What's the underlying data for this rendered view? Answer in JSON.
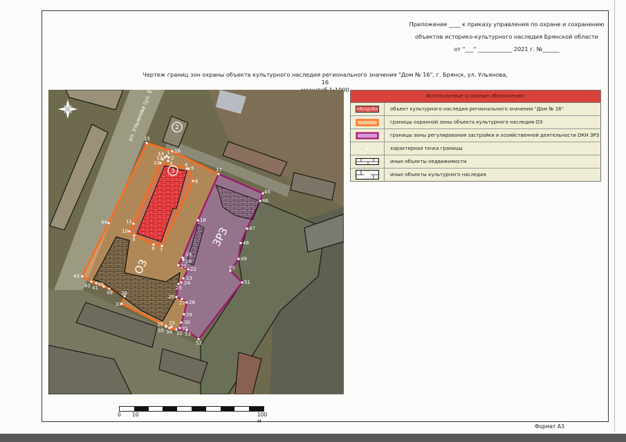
{
  "appendix": {
    "line1": "Приложение ____ к приказу управления по охране и сохранению",
    "line2": "объектов историко-культурного наследия Брянской области",
    "line3": "от \"___\" ____________ 2021 г. №______"
  },
  "title": {
    "main": "Чертеж границ зон охраны объекта культурного наследия регионального значения \"Дом № 16\", г. Брянск, ул. Ульянова, 16",
    "scale": "масштаб 1:1000"
  },
  "map": {
    "street_label": "ул. Ульянова (ул. Елза",
    "zone_oz_label": "ОЗ",
    "zone_zrz_label": "ЗРЗ",
    "object_numbers": [
      "2",
      "3"
    ],
    "compass_icon": "north-arrow-icon",
    "colors": {
      "oz_border": "#ff6a1a",
      "zrz_border": "#9c1a6e",
      "zrz_fill": "#b07ab8",
      "object_fill": "#d8282c"
    },
    "points": [
      "1",
      "2",
      "3",
      "4",
      "5",
      "6",
      "7",
      "8",
      "9",
      "10",
      "11",
      "12",
      "13",
      "14",
      "15",
      "16",
      "17",
      "18",
      "19",
      "20",
      "21",
      "22",
      "23",
      "24",
      "25",
      "26",
      "27",
      "28",
      "29",
      "30",
      "31",
      "32",
      "33",
      "34",
      "35",
      "36",
      "37",
      "38",
      "39",
      "40",
      "41",
      "42",
      "43",
      "44",
      "45",
      "46",
      "47",
      "48",
      "49",
      "50",
      "51",
      "52",
      "53"
    ]
  },
  "legend": {
    "header": "Используемые условные обозначения:",
    "items": [
      {
        "icon": "red-brick-icon",
        "label": "объект культурного наследия регионального значения \"Дом № 16\""
      },
      {
        "icon": "orange-border-icon",
        "label": "границы охранной зоны объекта культурного наследия ОЗ"
      },
      {
        "icon": "purple-border-icon",
        "label": "границы зоны регулирования застройки и хозяйственной деятельности ОКН ЗРЗ"
      },
      {
        "icon": "white-dot-icon",
        "label": "характерная точка границы"
      },
      {
        "icon": "black-brick-icon",
        "label": "иные объекты недвижимости"
      },
      {
        "icon": "heritage-brick-icon",
        "label": "иные объекты культурного наследия"
      }
    ]
  },
  "scale_bar": {
    "start": "0",
    "mid": "10",
    "end": "100 м"
  },
  "format": "Формат А3"
}
